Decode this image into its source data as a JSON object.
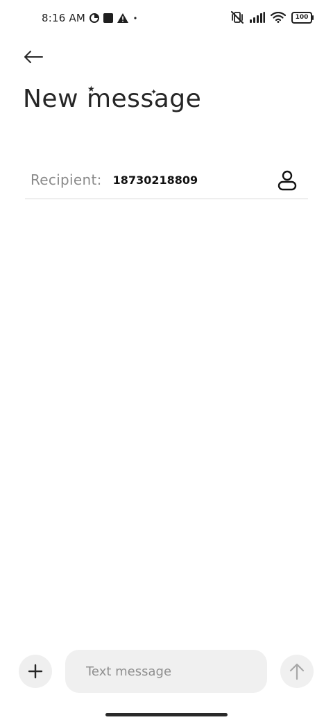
{
  "status_bar": {
    "time": "8:16 AM",
    "battery": "100",
    "icons": [
      "data-saver-icon",
      "square-notification-icon",
      "warning-icon",
      "dot-icon",
      "vibrate-off-icon",
      "signal-icon",
      "wifi-icon",
      "battery-icon"
    ]
  },
  "header": {
    "back_icon": "arrow-left-icon",
    "title": "New message"
  },
  "recipient": {
    "label": "Recipient:",
    "value": "18730218809",
    "contact_icon": "person-icon"
  },
  "composer": {
    "add_icon": "plus-icon",
    "placeholder": "Text message",
    "send_icon": "arrow-up-icon"
  },
  "colors": {
    "background": "#ffffff",
    "text": "#1f1f1f",
    "muted": "#8a8a8a",
    "field": "#f0f0f0",
    "divider": "#d7d7d7"
  }
}
